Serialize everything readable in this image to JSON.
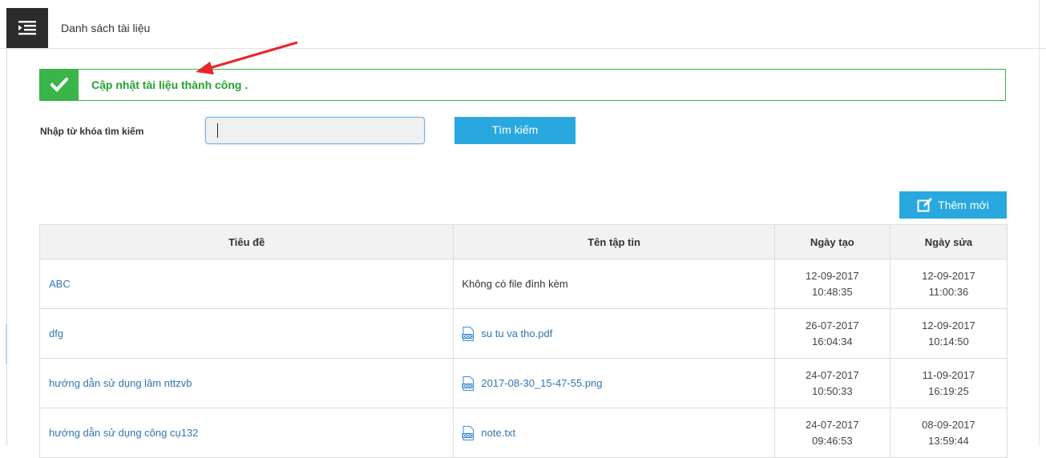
{
  "header": {
    "title": "Danh sách tài liệu",
    "menu_icon": "menu-icon"
  },
  "alert": {
    "message": "Cập nhật tài liệu thành công .",
    "icon": "check-icon",
    "color": "#3ab549"
  },
  "search": {
    "label": "Nhập từ khóa tìm kiếm",
    "value": "",
    "button_label": "Tìm kiếm"
  },
  "toolbar": {
    "add_label": "Thêm mới",
    "add_icon": "edit-icon"
  },
  "table": {
    "columns": [
      "Tiêu đề",
      "Tên tập tin",
      "Ngày tạo",
      "Ngày sửa"
    ],
    "rows": [
      {
        "title": "ABC",
        "file": "",
        "file_text": "Không có file đính kèm",
        "created_date": "12-09-2017",
        "created_time": "10:48:35",
        "modified_date": "12-09-2017",
        "modified_time": "11:00:36"
      },
      {
        "title": "dfg",
        "file": "su tu va tho.pdf",
        "file_text": "",
        "created_date": "26-07-2017",
        "created_time": "16:04:34",
        "modified_date": "12-09-2017",
        "modified_time": "10:14:50"
      },
      {
        "title": "hướng dẫn sử dụng lâm nttzvb",
        "file": "2017-08-30_15-47-55.png",
        "file_text": "",
        "created_date": "24-07-2017",
        "created_time": "10:50:33",
        "modified_date": "11-09-2017",
        "modified_time": "16:19:25"
      },
      {
        "title": "hướng dẫn sử dụng công cụ132",
        "file": "note.txt",
        "file_text": "",
        "created_date": "24-07-2017",
        "created_time": "09:46:53",
        "modified_date": "08-09-2017",
        "modified_time": "13:59:44"
      }
    ]
  },
  "colors": {
    "accent": "#29a8e0",
    "success": "#21a331",
    "link": "#3176b2",
    "annotation_arrow": "#e8262b"
  }
}
